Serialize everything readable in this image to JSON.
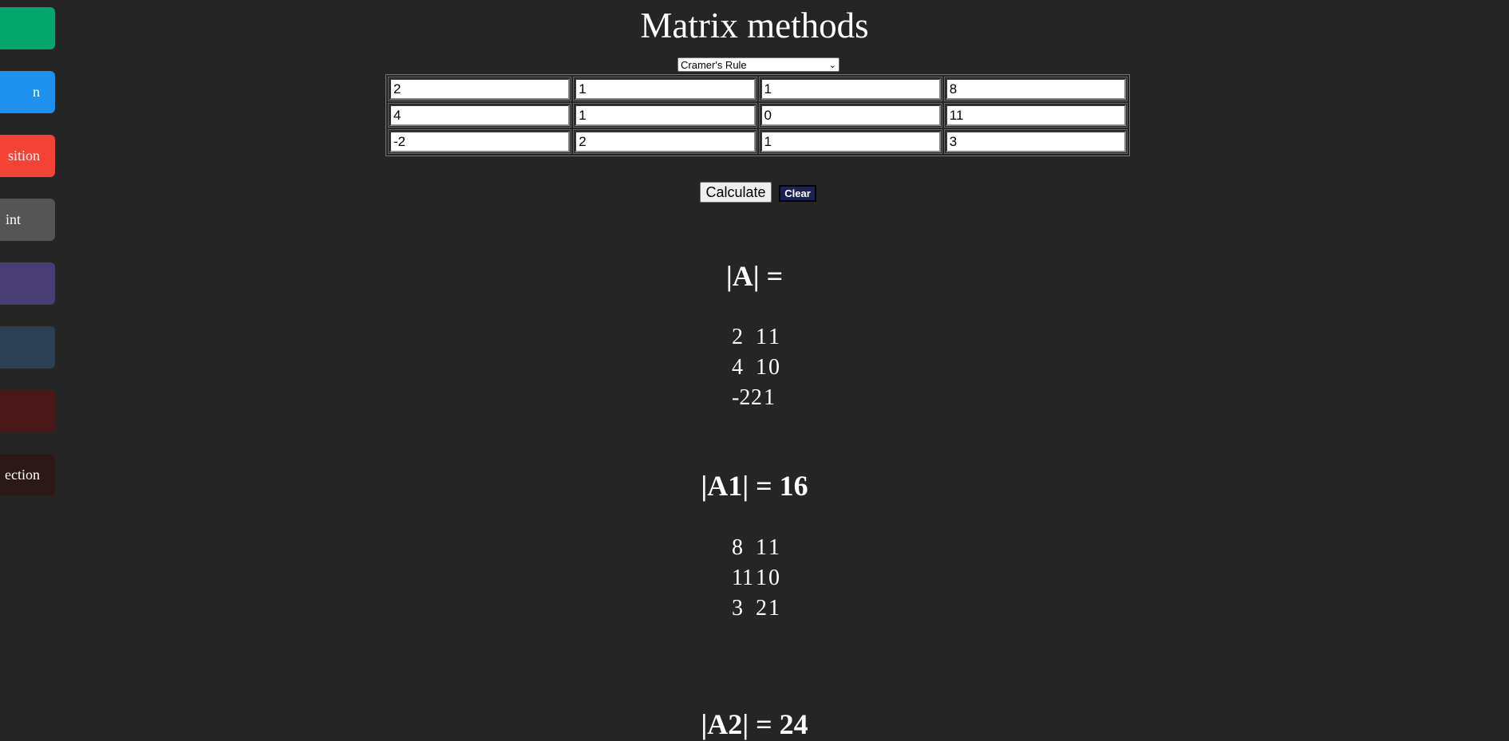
{
  "sidebar": {
    "items": [
      {
        "label": "",
        "color": "#05a86c"
      },
      {
        "label": "n",
        "color": "#1e90ee"
      },
      {
        "label": "sition",
        "color": "#f44336"
      },
      {
        "label": "int",
        "color": "#555555"
      },
      {
        "label": "",
        "color": "#483d74"
      },
      {
        "label": "",
        "color": "#2c4054"
      },
      {
        "label": "",
        "color": "#4a1818"
      },
      {
        "label": "ection",
        "color": "#2d1818"
      }
    ]
  },
  "header": {
    "title": "Matrix methods"
  },
  "method_select": {
    "selected": "Cramer's Rule",
    "icon": "chevron-down-icon"
  },
  "matrix": {
    "rows": [
      [
        "2",
        "1",
        "1",
        "8"
      ],
      [
        "4",
        "1",
        "0",
        "11"
      ],
      [
        "-2",
        "2",
        "1",
        "3"
      ]
    ]
  },
  "buttons": {
    "calculate": "Calculate",
    "clear": "Clear"
  },
  "results": [
    {
      "label": "|A| =",
      "rows": [
        [
          "2",
          "1",
          "1"
        ],
        [
          "4",
          "1",
          "0"
        ],
        [
          "-2",
          "2",
          "1"
        ]
      ]
    },
    {
      "label": "|A1| = 16",
      "rows": [
        [
          "8",
          "1",
          "1"
        ],
        [
          "11",
          "1",
          "0"
        ],
        [
          "3",
          "2",
          "1"
        ]
      ]
    },
    {
      "label": "|A2| = 24",
      "rows": []
    }
  ]
}
